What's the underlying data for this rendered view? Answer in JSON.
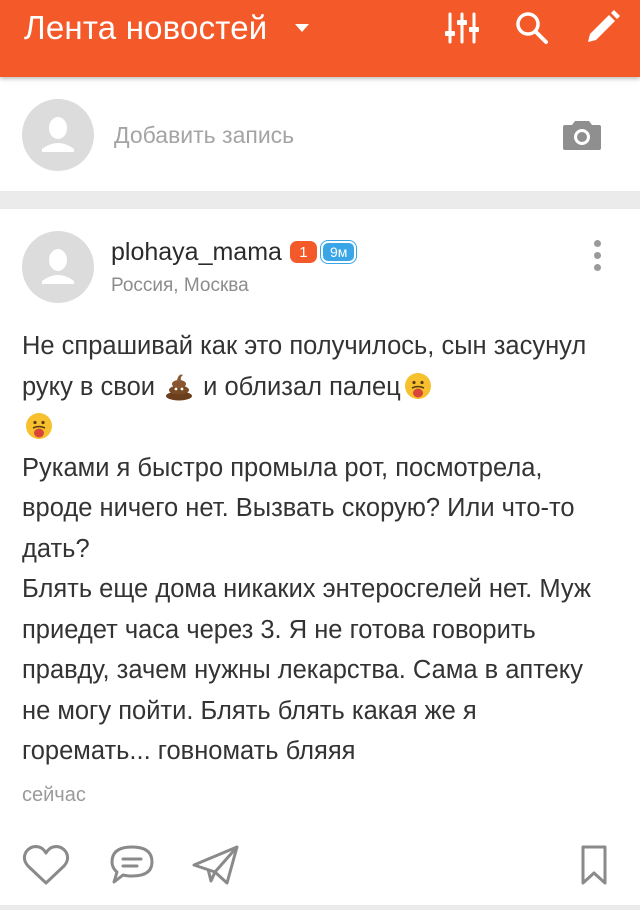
{
  "appbar": {
    "title": "Лента новостей",
    "icons": [
      "filter-sliders-icon",
      "search-icon",
      "pencil-icon"
    ],
    "color": "#f4592a"
  },
  "composer": {
    "placeholder": "Добавить запись",
    "icon": "camera-icon"
  },
  "post": {
    "author": "plohaya_mama",
    "badge_count": "1",
    "online_badge": "9м",
    "location": "Россия, Москва",
    "paragraphs": [
      {
        "before": "Не спрашивай как это получилось, сын засунул руку в свои ",
        "emoji1": "poop-emoji",
        "middle": " и облизал палец",
        "emoji2": "nauseated-face-emoji",
        "emoji3": "nauseated-face-emoji"
      },
      {
        "text": "Руками я быстро промыла рот, посмотрела, вроде ничего нет. Вызвать скорую? Или что-то дать?"
      },
      {
        "text": "Блять еще дома никаких энтеросгелей нет. Муж приедет часа через 3. Я не готова говорить правду, зачем нужны лекарства. Сама в аптеку не могу пойти. Блять блять какая же я горемать... говномать бляяя"
      }
    ],
    "time": "сейчас",
    "action_icons": [
      "heart-icon",
      "comment-icon",
      "share-paper-plane-icon",
      "bookmark-icon"
    ]
  }
}
